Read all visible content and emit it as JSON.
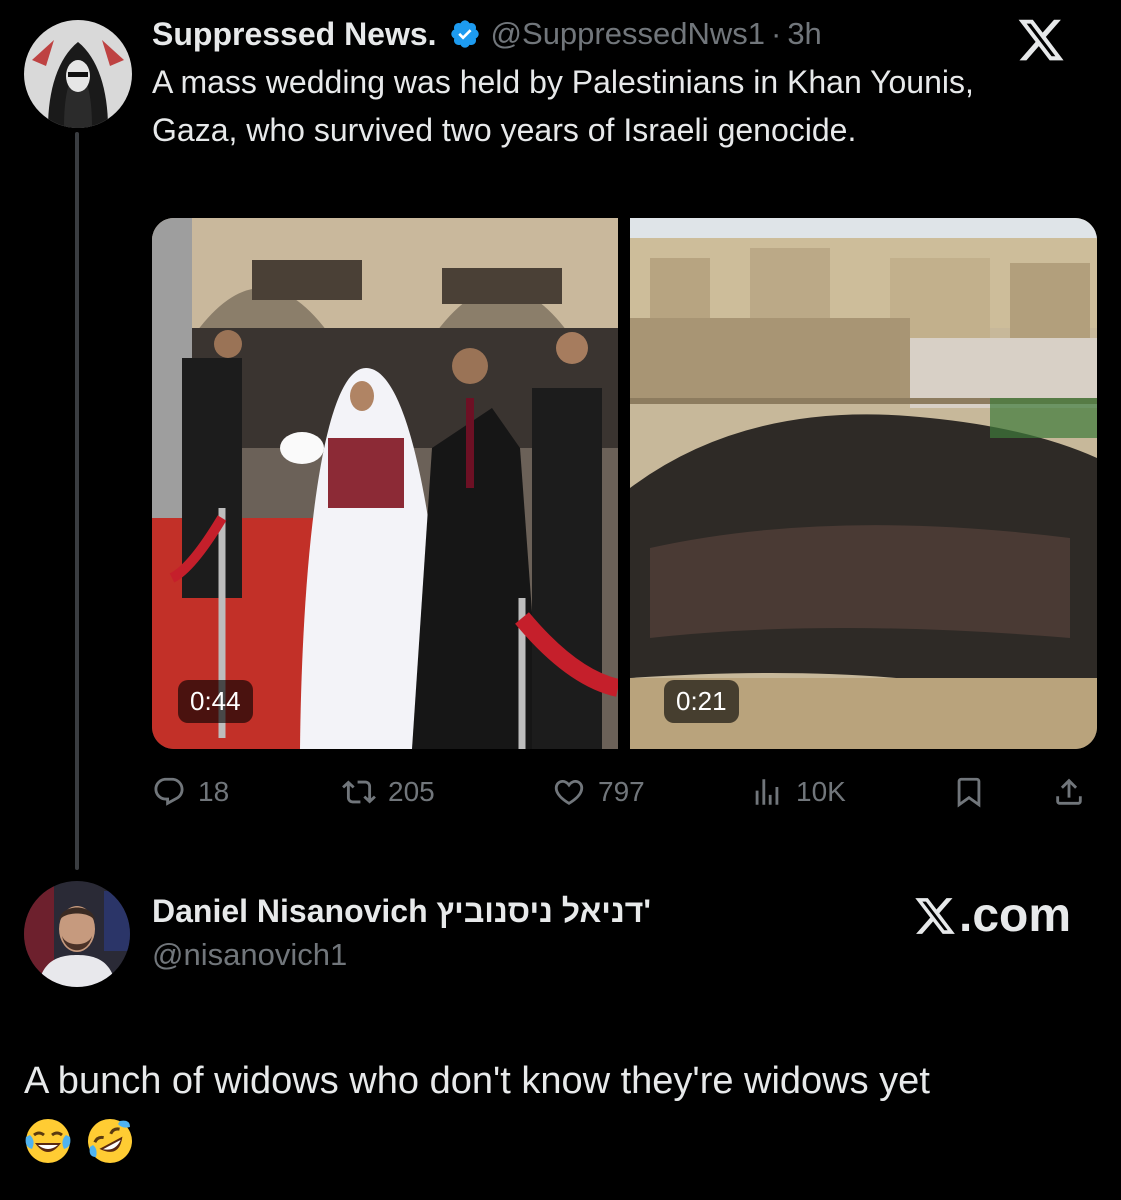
{
  "tweet": {
    "display_name": "Suppressed News.",
    "handle": "@SuppressedNws1",
    "separator": "·",
    "time": "3h",
    "text": "A mass wedding was held by Palestinians in Khan Younis, Gaza, who survived two years of Israeli genocide.",
    "media": [
      {
        "duration": "0:44"
      },
      {
        "duration": "0:21"
      }
    ],
    "stats": {
      "replies": "18",
      "retweets": "205",
      "likes": "797",
      "views": "10K"
    }
  },
  "reply": {
    "display_name": "Daniel Nisanovich דניאל ניסנוביץ'",
    "handle": "@nisanovich1",
    "text": "A bunch of widows who don't know they're widows yet",
    "emojis": [
      "face-with-tears-of-joy",
      "rolling-on-the-floor-laughing"
    ]
  },
  "brand": {
    "watermark": ".com"
  },
  "colors": {
    "background": "#000000",
    "primary_text": "#e7e9ea",
    "secondary_text": "#71767b",
    "verified": "#1d9bf0",
    "thread_line": "#3a3d41"
  }
}
